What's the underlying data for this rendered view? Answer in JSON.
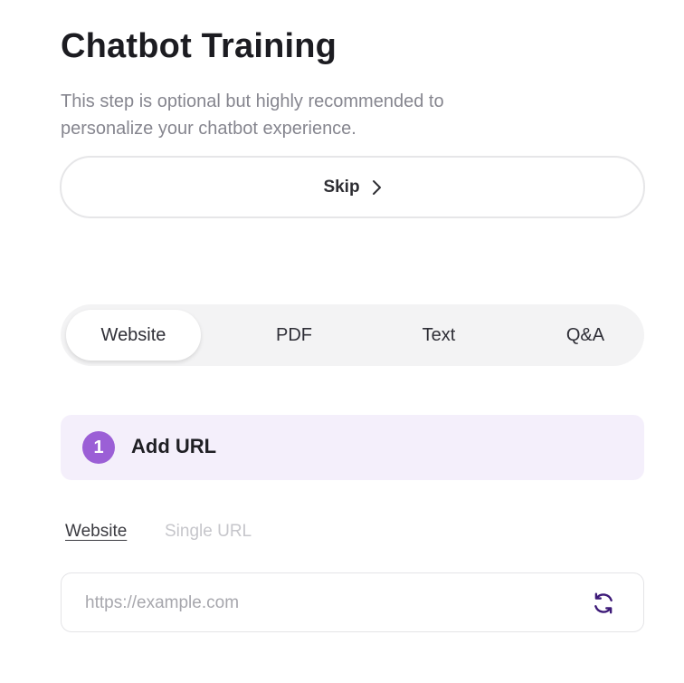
{
  "page": {
    "title": "Chatbot Training",
    "subtitle": "This step is optional but highly recommended to personalize your chatbot experience."
  },
  "skip": {
    "label": "Skip",
    "icon": "chevron-right-icon"
  },
  "tabs": [
    {
      "label": "Website",
      "active": true
    },
    {
      "label": "PDF",
      "active": false
    },
    {
      "label": "Text",
      "active": false
    },
    {
      "label": "Q&A",
      "active": false
    }
  ],
  "step": {
    "number": "1",
    "title": "Add URL",
    "accent_color": "#9b5fd6",
    "background_color": "#f4effb"
  },
  "subtabs": [
    {
      "label": "Website",
      "active": true
    },
    {
      "label": "Single URL",
      "active": false
    }
  ],
  "url_input": {
    "placeholder": "https://example.com",
    "value": "",
    "action_icon": "refresh-icon",
    "icon_color": "#3d1a78"
  }
}
